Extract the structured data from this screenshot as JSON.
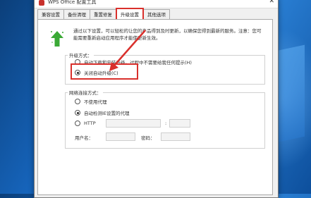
{
  "window": {
    "title": "WPS Office 配置工具",
    "close_glyph": "✕"
  },
  "tabs": [
    {
      "label": "兼容设置",
      "active": false
    },
    {
      "label": "备份清理",
      "active": false
    },
    {
      "label": "重置修复",
      "active": false
    },
    {
      "label": "升级设置",
      "active": true
    },
    {
      "label": "其他选项",
      "active": false
    }
  ],
  "description": "通过以下设置，可以轻松的让您的产品得到及时更新，以确保您得到最新的服务。注意：您可能需要重新启动应用程序才能使更新生效。",
  "upgrade_mode": {
    "label": "升级方式：",
    "options": [
      {
        "label": "自动下载和安装升级。过程中不需要给我任何提示(H)",
        "selected": false
      },
      {
        "label": "关闭自动升级(C)",
        "selected": true
      }
    ]
  },
  "network": {
    "label": "网络连接方式：",
    "options": [
      {
        "label": "不使用代理",
        "selected": false
      },
      {
        "label": "自动检测IE设置的代理",
        "selected": true
      },
      {
        "label": "HTTP",
        "selected": false
      }
    ],
    "port_separator": ":",
    "username_label": "用户名：",
    "password_label": "密码："
  },
  "colors": {
    "highlight": "#d9302c",
    "accent_green": "#3aa935"
  },
  "icons": [
    "app-icon",
    "close-icon",
    "upgrade-arrow-icon",
    "annotation-arrow-icon"
  ]
}
